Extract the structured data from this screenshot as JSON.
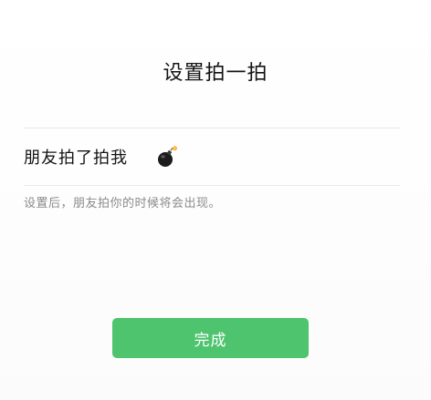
{
  "header": {
    "title": "设置拍一拍"
  },
  "setting_row": {
    "label": "朋友拍了拍我",
    "value_icon": "bomb-icon"
  },
  "hint_text": "设置后，朋友拍你的时候将会出现。",
  "footer": {
    "done_label": "完成"
  },
  "colors": {
    "accent": "#4ec46e",
    "hint": "#8a8a8a",
    "divider": "#e8e8e8"
  }
}
